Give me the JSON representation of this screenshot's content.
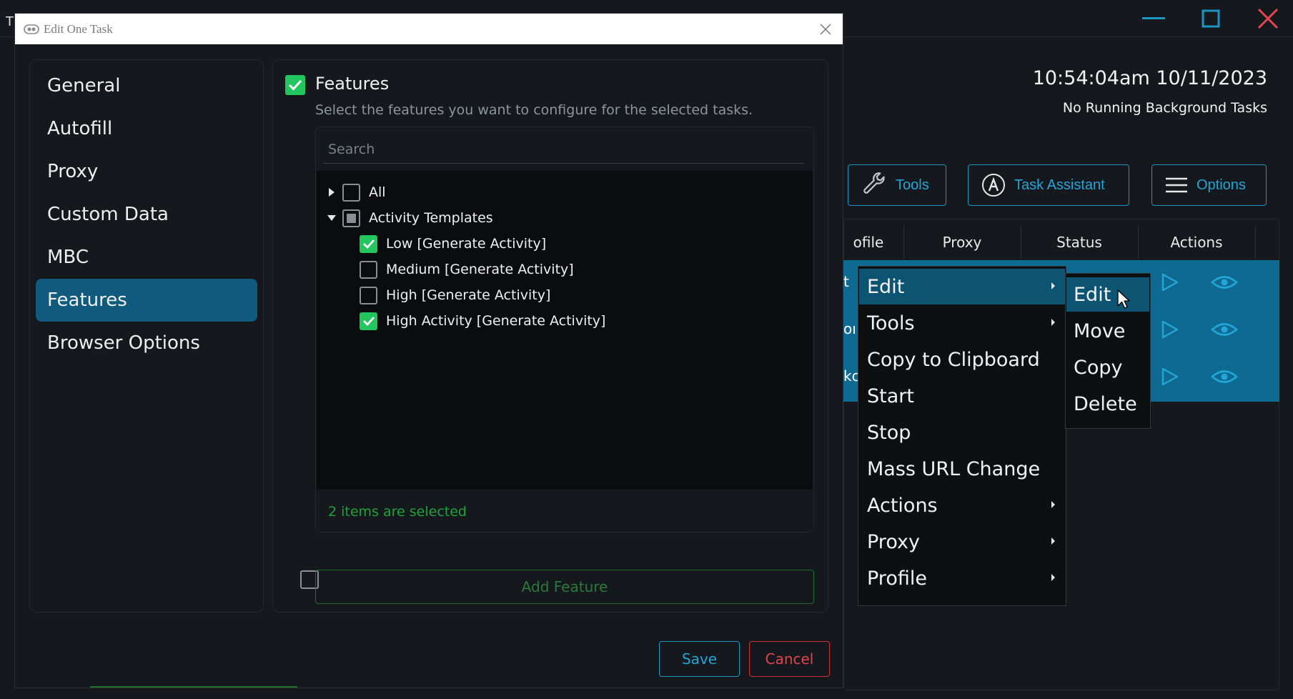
{
  "app": {
    "title_fragment": "T",
    "clock": "10:54:04am 10/11/2023",
    "background_status": "No Running Background Tasks",
    "toolbar": {
      "tools_label": "Tools",
      "task_assistant_label": "Task Assistant",
      "options_label": "Options"
    },
    "table": {
      "columns": [
        "ofile",
        "Proxy",
        "Status",
        "Actions"
      ],
      "row_fragments": [
        "t",
        "oı",
        "kc"
      ]
    }
  },
  "dialog": {
    "title": "Edit One Task",
    "nav": [
      {
        "label": "General",
        "active": false
      },
      {
        "label": "Autofill",
        "active": false
      },
      {
        "label": "Proxy",
        "active": false
      },
      {
        "label": "Custom Data",
        "active": false
      },
      {
        "label": "MBC",
        "active": false
      },
      {
        "label": "Features",
        "active": true
      },
      {
        "label": "Browser Options",
        "active": false
      }
    ],
    "features": {
      "title": "Features",
      "checked": true,
      "description": "Select the features you want to configure for the selected tasks.",
      "search_placeholder": "Search",
      "tree": [
        {
          "label": "All",
          "state": "unchecked",
          "expander": "collapsed",
          "level": 0
        },
        {
          "label": "Activity Templates",
          "state": "partial",
          "expander": "expanded",
          "level": 0
        },
        {
          "label": "Low [Generate Activity]",
          "state": "checked",
          "level": 1
        },
        {
          "label": "Medium [Generate Activity]",
          "state": "unchecked",
          "level": 1
        },
        {
          "label": "High [Generate Activity]",
          "state": "unchecked",
          "level": 1
        },
        {
          "label": "High Activity [Generate Activity]",
          "state": "checked",
          "level": 1
        }
      ],
      "selection_summary": "2 items are selected",
      "add_feature_label": "Add Feature"
    },
    "save_label": "Save",
    "cancel_label": "Cancel"
  },
  "context_menu": {
    "items": [
      {
        "label": "Edit",
        "submenu": true,
        "highlighted": true
      },
      {
        "label": "Tools",
        "submenu": true,
        "highlighted": false
      },
      {
        "label": "Copy to Clipboard",
        "submenu": false,
        "highlighted": false
      },
      {
        "label": "Start",
        "submenu": false,
        "highlighted": false
      },
      {
        "label": "Stop",
        "submenu": false,
        "highlighted": false
      },
      {
        "label": "Mass URL Change",
        "submenu": false,
        "highlighted": false
      },
      {
        "label": "Actions",
        "submenu": true,
        "highlighted": false
      },
      {
        "label": "Proxy",
        "submenu": true,
        "highlighted": false
      },
      {
        "label": "Profile",
        "submenu": true,
        "highlighted": false
      }
    ],
    "submenu": [
      {
        "label": "Edit",
        "highlighted": true
      },
      {
        "label": "Move",
        "highlighted": false
      },
      {
        "label": "Copy",
        "highlighted": false
      },
      {
        "label": "Delete",
        "highlighted": false
      }
    ]
  },
  "colors": {
    "background": "#15181c",
    "accent_blue": "#1c95c4",
    "selected_row": "#0e6a91",
    "check_green": "#22c55e",
    "danger_red": "#d32f3a",
    "menu_highlight": "#0d5472"
  }
}
